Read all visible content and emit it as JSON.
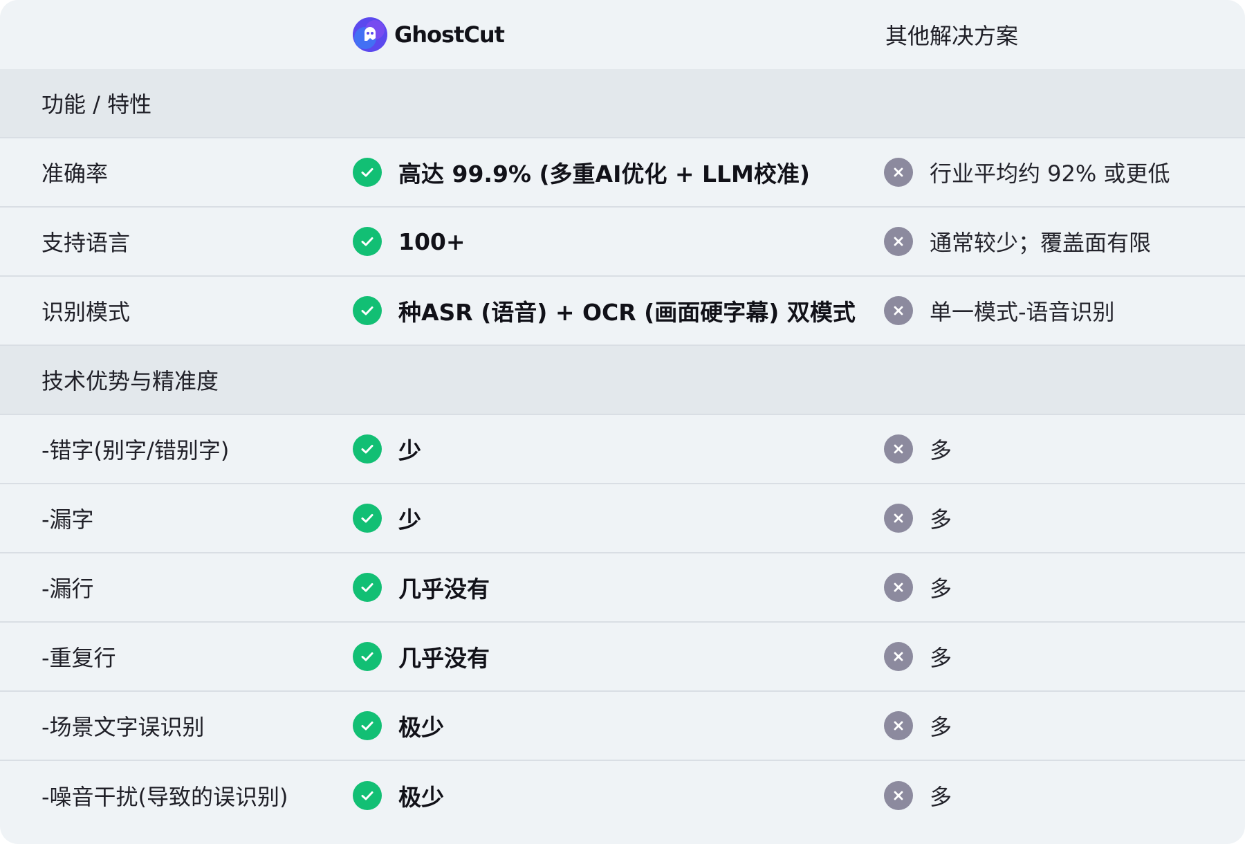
{
  "header": {
    "brand": "GhostCut",
    "other_title": "其他解决方案"
  },
  "colors": {
    "check": "#12bf74",
    "cross": "#8c8a9e",
    "section_bg": "#e3e8ec",
    "row_bg": "#eff3f6",
    "brand": "#6b50f0"
  },
  "icons": {
    "positive": "check-circle-icon",
    "negative": "x-circle-icon",
    "brand": "ghost-logo-icon"
  },
  "sections": [
    {
      "title": "功能 / 特性",
      "rows": [
        {
          "feature": "准确率",
          "ghostcut": "高达 99.9% (多重AI优化 + LLM校准)",
          "other": "行业平均约 92% 或更低"
        },
        {
          "feature": "支持语言",
          "ghostcut": "100+",
          "other": "通常较少；覆盖面有限"
        },
        {
          "feature": "识别模式",
          "ghostcut": "种ASR (语音) + OCR (画面硬字幕) 双模式",
          "other": "单一模式-语音识别"
        }
      ]
    },
    {
      "title": "技术优势与精准度",
      "rows": [
        {
          "feature": "-错字(别字/错别字)",
          "ghostcut": "少",
          "other": "多"
        },
        {
          "feature": "-漏字",
          "ghostcut": "少",
          "other": "多"
        },
        {
          "feature": "-漏行",
          "ghostcut": "几乎没有",
          "other": "多"
        },
        {
          "feature": "-重复行",
          "ghostcut": "几乎没有",
          "other": "多"
        },
        {
          "feature": "-场景文字误识别",
          "ghostcut": "极少",
          "other": "多"
        },
        {
          "feature": "-噪音干扰(导致的误识别)",
          "ghostcut": "极少",
          "other": "多"
        }
      ]
    }
  ]
}
